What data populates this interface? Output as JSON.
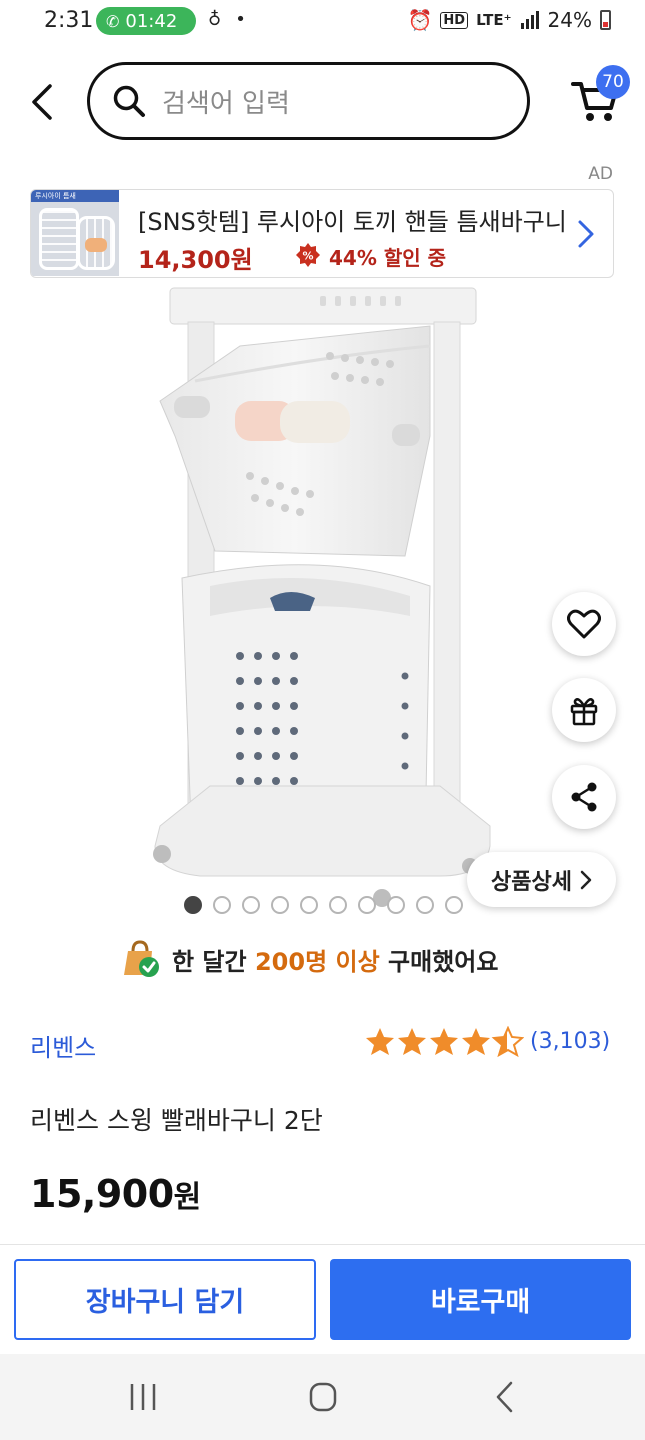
{
  "status_bar": {
    "time": "2:31",
    "call_timer": "01:42",
    "network": "HD",
    "lte": "LTE⁺",
    "battery": "24%"
  },
  "header": {
    "search_placeholder": "검색어 입력",
    "cart_count": "70"
  },
  "ad": {
    "label": "AD",
    "thumb_text": "루시아이 틈새",
    "title": "[SNS핫템] 루시아이 토끼 핸들 틈새바구니",
    "price": "14,300원",
    "discount": "44% 할인 중",
    "price_color": "#b4241a"
  },
  "gallery": {
    "total_images": 10,
    "active_index": 0,
    "detail_label": "상품상세"
  },
  "social_proof": {
    "prefix": "한 달간",
    "highlight": "200명 이상",
    "suffix": "구매했어요",
    "highlight_color": "#d46a0e"
  },
  "product": {
    "brand": "리벤스",
    "rating": 4.5,
    "review_count": "(3,103)",
    "name": "리벤스 스윙 빨래바구니 2단",
    "price_number": "15,900",
    "price_unit": "원"
  },
  "actions": {
    "add_to_cart": "장바구니 담기",
    "buy_now": "바로구매",
    "accent_color": "#2d6ef0"
  },
  "icons": [
    "back-icon",
    "search-icon",
    "cart-icon",
    "heart-icon",
    "gift-icon",
    "share-icon",
    "chevron-right-icon",
    "recent-apps-icon",
    "home-icon",
    "back-nav-icon"
  ]
}
